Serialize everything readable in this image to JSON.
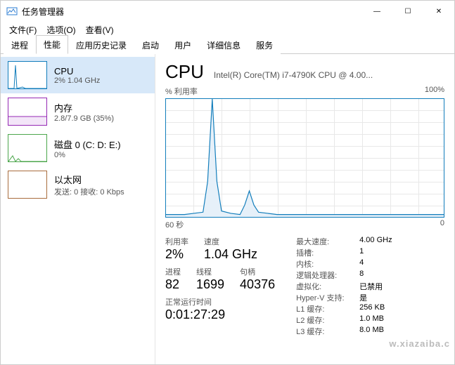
{
  "window": {
    "title": "任务管理器",
    "min": "—",
    "max": "☐",
    "close": "✕"
  },
  "menu": {
    "file": "文件(F)",
    "options": "选项(O)",
    "view": "查看(V)"
  },
  "tabs": {
    "processes": "进程",
    "performance": "性能",
    "history": "应用历史记录",
    "startup": "启动",
    "users": "用户",
    "details": "详细信息",
    "services": "服务"
  },
  "sidebar": {
    "cpu": {
      "name": "CPU",
      "sub": "2% 1.04 GHz"
    },
    "mem": {
      "name": "内存",
      "sub": "2.8/7.9 GB (35%)"
    },
    "disk": {
      "name": "磁盘 0 (C: D: E:)",
      "sub": "0%"
    },
    "eth": {
      "name": "以太网",
      "sub": "发送: 0 接收: 0 Kbps"
    }
  },
  "main": {
    "title": "CPU",
    "model": "Intel(R) Core(TM) i7-4790K CPU @ 4.00...",
    "util_axis_label": "% 利用率",
    "util_axis_max": "100%",
    "time_axis_left": "60 秒",
    "time_axis_right": "0",
    "labels": {
      "util": "利用率",
      "speed": "速度",
      "processes": "进程",
      "threads": "线程",
      "handles": "句柄",
      "uptime": "正常运行时间"
    },
    "values": {
      "util": "2%",
      "speed": "1.04 GHz",
      "processes": "82",
      "threads": "1699",
      "handles": "40376",
      "uptime": "0:01:27:29"
    },
    "right": {
      "maxspeed_k": "最大速度:",
      "maxspeed_v": "4.00 GHz",
      "sockets_k": "插槽:",
      "sockets_v": "1",
      "cores_k": "内核:",
      "cores_v": "4",
      "logical_k": "逻辑处理器:",
      "logical_v": "8",
      "virt_k": "虚拟化:",
      "virt_v": "已禁用",
      "hyperv_k": "Hyper-V 支持:",
      "hyperv_v": "是",
      "l1_k": "L1 缓存:",
      "l1_v": "256 KB",
      "l2_k": "L2 缓存:",
      "l2_v": "1.0 MB",
      "l3_k": "L3 缓存:",
      "l3_v": "8.0 MB"
    }
  },
  "chart_data": {
    "type": "line",
    "title": "% 利用率",
    "xlabel": "秒",
    "ylabel": "% 利用率",
    "ylim": [
      0,
      100
    ],
    "xlim": [
      60,
      0
    ],
    "x": [
      60,
      58,
      56,
      54,
      52,
      51,
      50,
      49,
      48,
      46,
      44,
      43,
      42,
      41,
      40,
      38,
      36,
      34,
      32,
      30,
      28,
      26,
      24,
      22,
      20,
      18,
      16,
      14,
      12,
      10,
      8,
      6,
      4,
      2,
      0
    ],
    "values": [
      2,
      2,
      2,
      3,
      4,
      30,
      100,
      30,
      5,
      3,
      2,
      10,
      22,
      10,
      4,
      3,
      2,
      2,
      2,
      2,
      2,
      2,
      2,
      2,
      2,
      2,
      2,
      2,
      2,
      2,
      2,
      2,
      2,
      2,
      2
    ]
  },
  "watermark": "w.xiazaiba.c"
}
